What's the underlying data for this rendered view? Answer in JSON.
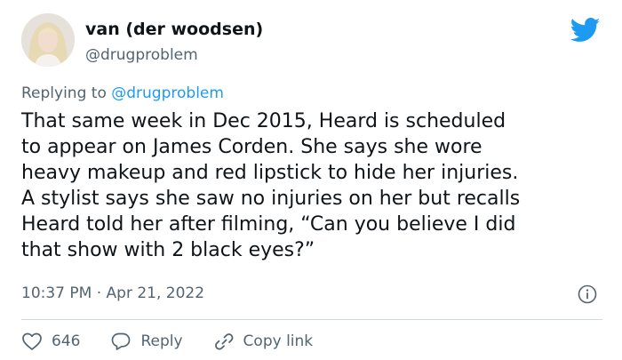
{
  "tweet": {
    "author_name": "van (der woodsen)",
    "author_handle": "@drugproblem",
    "replying_prefix": "Replying to",
    "replying_handle": "@drugproblem",
    "text": "That same week in Dec 2015, Heard is scheduled\nto appear on James Corden. She says she wore\nheavy makeup and red lipstick to hide her injuries.\nA stylist says she saw no injuries on her but recalls\nHeard told her after filming, “Can you believe I did\nthat show with 2 black eyes?”",
    "timestamp": "10:37 PM · Apr 21, 2022"
  },
  "actions": {
    "like_count": "646",
    "reply_label": "Reply",
    "copy_link_label": "Copy link"
  },
  "icons": {
    "brand": "twitter-bird-icon",
    "info": "info-icon",
    "like": "heart-icon",
    "reply": "reply-bubble-icon",
    "copy": "link-icon"
  },
  "colors": {
    "brand_blue": "#1d9bf0",
    "text_primary": "#0f1419",
    "text_secondary": "#536471",
    "divider": "#cfd9de"
  }
}
